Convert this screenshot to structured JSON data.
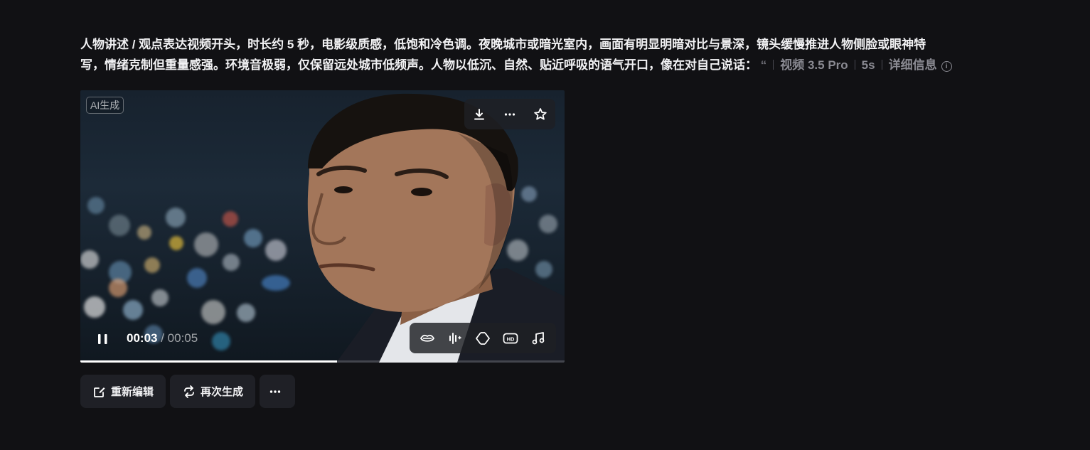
{
  "prompt": {
    "line1": "人物讲述 / 观点表达视频开头，时长约 5 秒，电影级质感，低饱和冷色调。夜晚城市或暗光室内，画面有明显明暗对比与景深，镜头缓慢推进人物侧脸或眼神特",
    "line2": "写，情绪克制但重量感强。环境音极弱，仅保留远处城市低频声。人物以低沉、自然、贴近呼吸的语气开口，像在对自己说话：",
    "quote_fragment": "“",
    "model": "视频 3.5 Pro",
    "duration": "5s",
    "details_label": "详细信息"
  },
  "video": {
    "badge": "AI生成",
    "current_time": "00:03",
    "separator": " / ",
    "total_time": "00:05",
    "progress_fraction": 0.53,
    "top_icons": [
      "download-icon",
      "more-icon",
      "star-icon"
    ],
    "bottom_icons": [
      "lip-sync-icon",
      "voice-edit-icon",
      "extend-icon",
      "hd-icon",
      "music-icon"
    ]
  },
  "actions": {
    "reedit_label": "重新编辑",
    "regenerate_label": "再次生成",
    "more_icon": "more-icon"
  }
}
